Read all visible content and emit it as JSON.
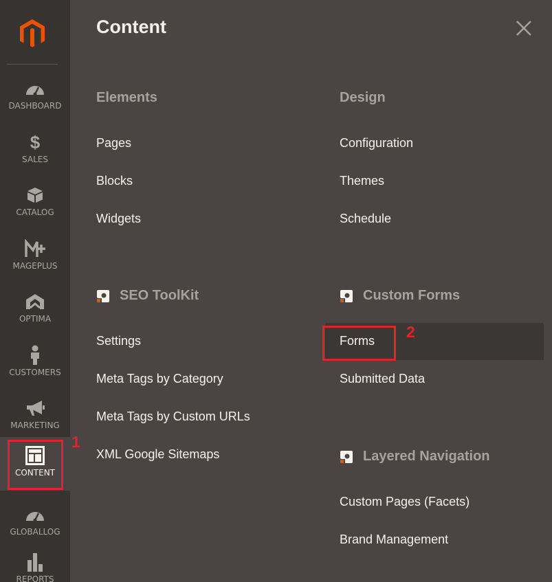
{
  "sidebar": {
    "logo": "magento-logo-icon",
    "items": [
      {
        "label": "DASHBOARD",
        "icon": "dashboard-gauge-icon"
      },
      {
        "label": "SALES",
        "icon": "dollar-icon"
      },
      {
        "label": "CATALOG",
        "icon": "box-icon"
      },
      {
        "label": "MAGEPLUS",
        "icon": "mageplus-icon"
      },
      {
        "label": "OPTIMA",
        "icon": "optima-icon"
      },
      {
        "label": "CUSTOMERS",
        "icon": "person-icon"
      },
      {
        "label": "MARKETING",
        "icon": "megaphone-icon"
      },
      {
        "label": "CONTENT",
        "icon": "layout-icon",
        "active": true
      },
      {
        "label": "GLOBALLOG",
        "icon": "globallog-gauge-icon"
      },
      {
        "label": "REPORTS",
        "icon": "bar-chart-icon"
      }
    ]
  },
  "panel": {
    "title": "Content",
    "close_icon": "close-icon",
    "sections": {
      "elements": {
        "title": "Elements",
        "links": [
          "Pages",
          "Blocks",
          "Widgets"
        ]
      },
      "design": {
        "title": "Design",
        "links": [
          "Configuration",
          "Themes",
          "Schedule"
        ]
      },
      "seo_toolkit": {
        "title": "SEO ToolKit",
        "icon": "amasty-icon",
        "links": [
          "Settings",
          "Meta Tags by Category",
          "Meta Tags by Custom URLs",
          "XML Google Sitemaps"
        ]
      },
      "custom_forms": {
        "title": "Custom Forms",
        "icon": "amasty-icon",
        "links": [
          "Forms",
          "Submitted Data"
        ]
      },
      "layered_navigation": {
        "title": "Layered Navigation",
        "icon": "amasty-icon",
        "links": [
          "Custom Pages (Facets)",
          "Brand Management"
        ]
      }
    }
  },
  "annotations": {
    "step_1": "1",
    "step_2": "2"
  },
  "colors": {
    "sidebar_bg": "#373330",
    "panel_bg": "#4a4542",
    "accent_orange": "#eb5202",
    "highlight_red": "#e2232b",
    "section_title": "#a6a29c",
    "link_text": "#f7f3eb"
  }
}
